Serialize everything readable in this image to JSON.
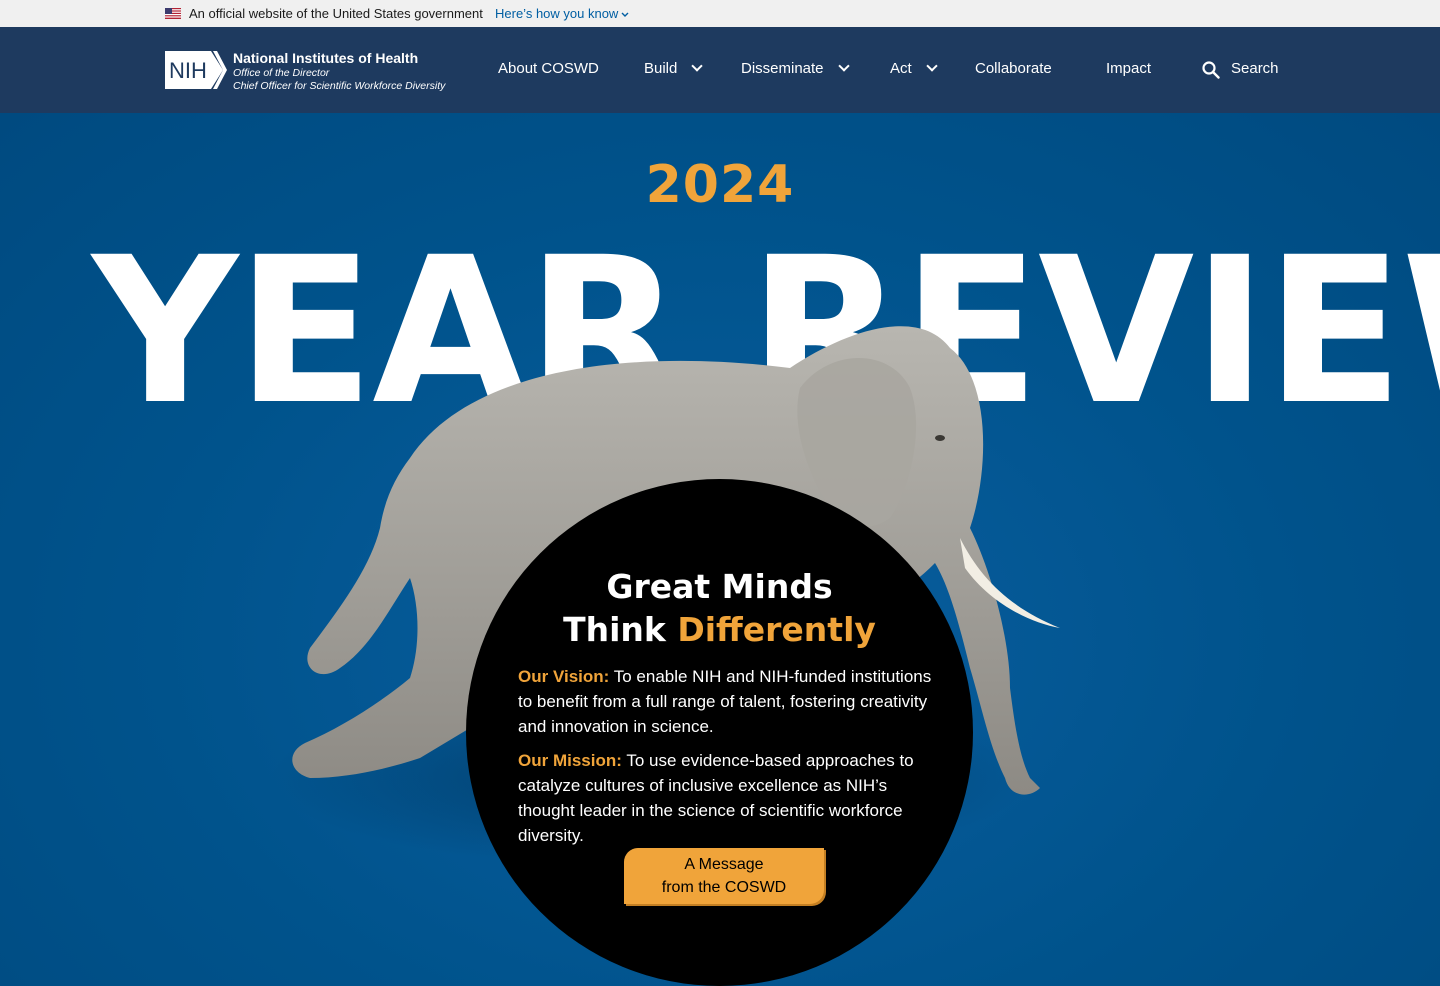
{
  "gov_banner": {
    "official_text": "An official website of the United States government",
    "how_you_know": "Here’s how you know"
  },
  "header": {
    "logo_mark": "NIH",
    "logo_line1": "National Institutes of Health",
    "logo_line2": "Office of the Director",
    "logo_line3": "Chief Officer for Scientific Workforce Diversity",
    "nav": [
      {
        "label": "About COSWD",
        "has_dropdown": false
      },
      {
        "label": "Build",
        "has_dropdown": true
      },
      {
        "label": "Disseminate",
        "has_dropdown": true
      },
      {
        "label": "Act",
        "has_dropdown": true
      },
      {
        "label": "Collaborate",
        "has_dropdown": false
      },
      {
        "label": "Impact",
        "has_dropdown": false
      }
    ],
    "search_label": "Search"
  },
  "hero": {
    "year": "2024",
    "title": "YEAR REVIEW",
    "circle_title_line1": "Great Minds",
    "circle_title_line2_a": "Think ",
    "circle_title_line2_b": "Differently",
    "vision_label": "Our Vision:",
    "vision_text": " To enable NIH and NIH-funded institutions to benefit from a full range of talent, fostering creativity and innovation in science.",
    "mission_label": "Our Mission:",
    "mission_text": " To use evidence-based approaches to catalyze cultures of inclusive excellence as NIH’s thought leader in the science of scientific workforce diversity.",
    "cta_line1": "A Message",
    "cta_line2": "from the COSWD"
  },
  "colors": {
    "banner_bg": "#f0f0f0",
    "header_bg": "#1e3a5f",
    "hero_bg": "#00538c",
    "accent": "#f0a43a",
    "circle_bg": "#000000"
  },
  "icons": [
    "us-flag-icon",
    "chevron-down-icon",
    "nih-logo",
    "search-icon",
    "elephant-image"
  ]
}
